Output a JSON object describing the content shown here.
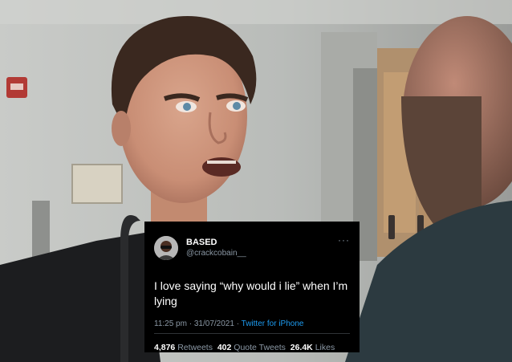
{
  "tweet": {
    "display_name": "BASED",
    "handle": "@crackcobain__",
    "more_icon": "more-icon",
    "text": "I love saying “why would i lie” when I’m lying",
    "time": "11:25 pm",
    "date": "31/07/2021",
    "separator": "·",
    "source": "Twitter for iPhone",
    "retweets_count": "4,876",
    "retweets_label": "Retweets",
    "quotes_count": "402",
    "quotes_label": "Quote Tweets",
    "likes_count": "26.4K",
    "likes_label": "Likes"
  },
  "colors": {
    "card_bg": "#000000",
    "secondary_text": "#8b98a5",
    "link": "#1d9bf0"
  }
}
